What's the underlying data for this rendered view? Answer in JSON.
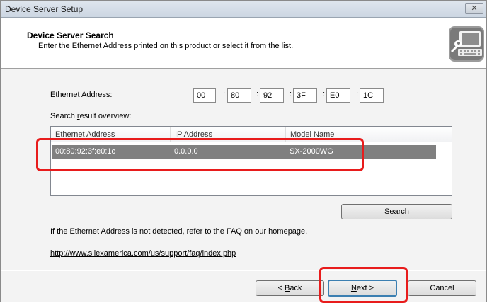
{
  "window": {
    "title": "Device Server Setup",
    "close_glyph": "✕"
  },
  "header": {
    "title": "Device Server Search",
    "subtitle": "Enter the Ethernet Address printed on this product or select it from the list.",
    "logo_icon": "computer-wrench-icon"
  },
  "ethernet": {
    "label_underlined": "E",
    "label_rest": "thernet Address:",
    "octets": [
      "00",
      "80",
      "92",
      "3F",
      "E0",
      "1C"
    ],
    "separator": ":"
  },
  "search_results": {
    "label_pre": "Search ",
    "label_underlined": "r",
    "label_post": "esult overview:",
    "columns": [
      "Ethernet Address",
      "IP Address",
      "Model Name"
    ],
    "rows": [
      {
        "ethernet": "00:80:92:3f:e0:1c",
        "ip": "0.0.0.0",
        "model": "SX-2000WG"
      }
    ]
  },
  "search_button": {
    "underlined": "S",
    "rest": "earch"
  },
  "faq_text": "If the Ethernet Address is not detected, refer to the FAQ on our homepage.",
  "faq_link": "http://www.silexamerica.com/us/support/faq/index.php",
  "footer": {
    "back_pre": "< ",
    "back_underlined": "B",
    "back_rest": "ack",
    "next_underlined": "N",
    "next_rest": "ext >",
    "cancel": "Cancel"
  },
  "colors": {
    "selection": "#808080",
    "annotation": "#e81c1c"
  }
}
